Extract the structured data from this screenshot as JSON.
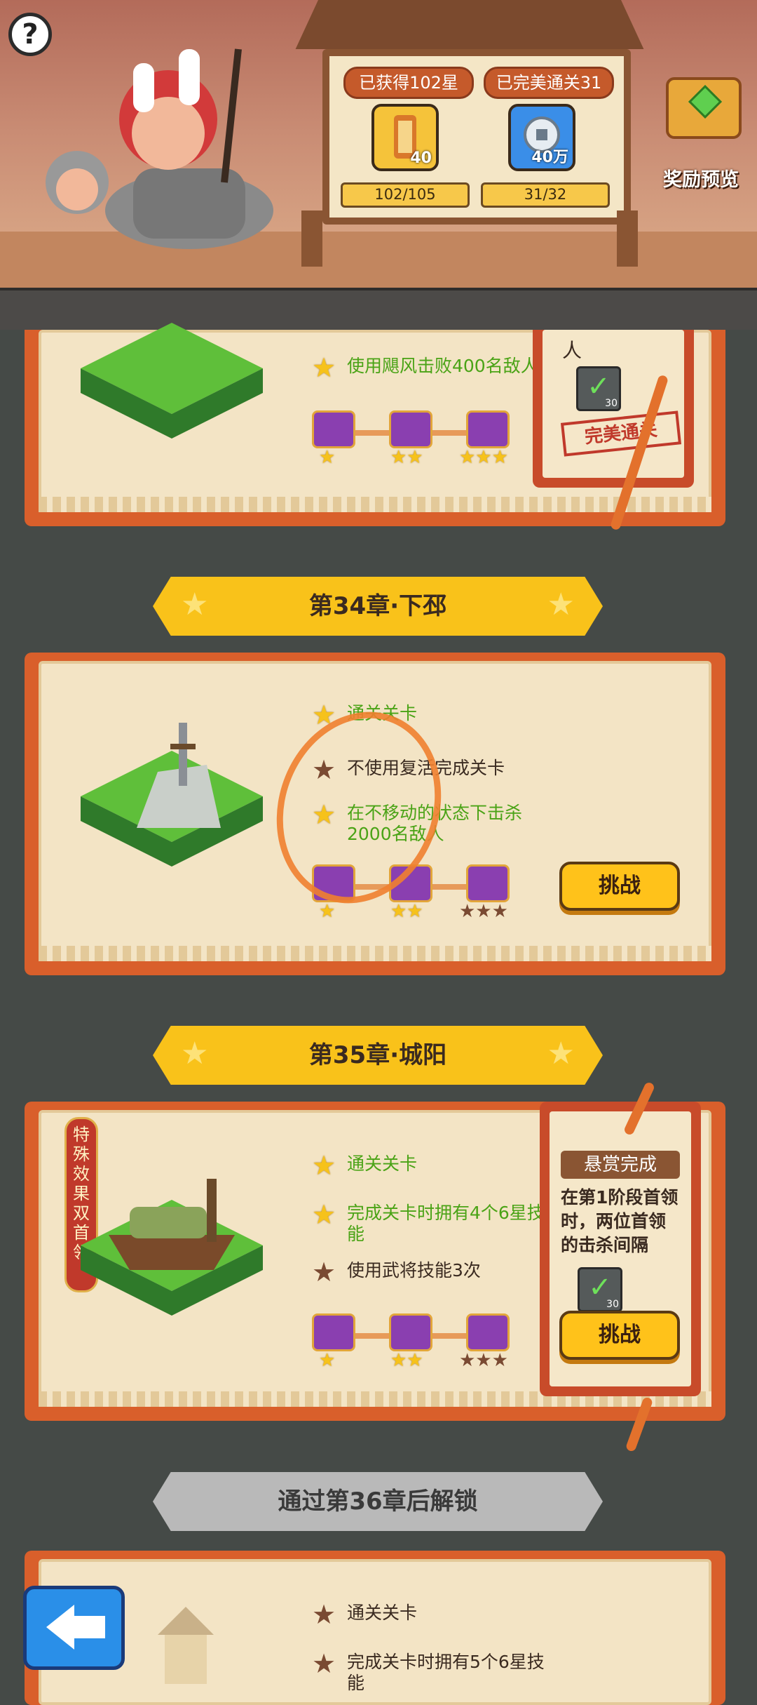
{
  "header": {
    "help_icon": "question-mark-icon",
    "stars_label": "已获得102星",
    "perfect_label": "已完美通关31",
    "reward1_count": "40",
    "reward2_count": "40万",
    "progress1": "102/105",
    "progress2": "31/32",
    "reward_preview": "奖励预览"
  },
  "chapter33": {
    "task1": "使用飓风击败400名敌人",
    "side_text": "人",
    "check_count": "30",
    "stamp": "完美通关"
  },
  "chapter34": {
    "title": "第34章·下邳",
    "task1": "通关关卡",
    "task2": "不使用复活完成关卡",
    "task3": "在不移动的状态下击杀2000名敌人",
    "button": "挑战"
  },
  "chapter35": {
    "title": "第35章·城阳",
    "tag": "特殊效果 双首领",
    "task1": "通关关卡",
    "task2": "完成关卡时拥有4个6星技能",
    "task3": "使用武将技能3次",
    "bounty_title": "悬赏完成",
    "bounty_text": "在第1阶段首领时，两位首领的击杀间隔",
    "check_count": "30",
    "button": "挑战"
  },
  "chapter36": {
    "locked_title": "通过第36章后解锁",
    "task1": "通关关卡",
    "task2": "完成关卡时拥有5个6星技能"
  },
  "colors": {
    "card": "#d95f2b",
    "paper": "#f3e4c5",
    "banner": "#f9c21a",
    "button": "#ffc21a",
    "task_green": "#4aa316"
  }
}
